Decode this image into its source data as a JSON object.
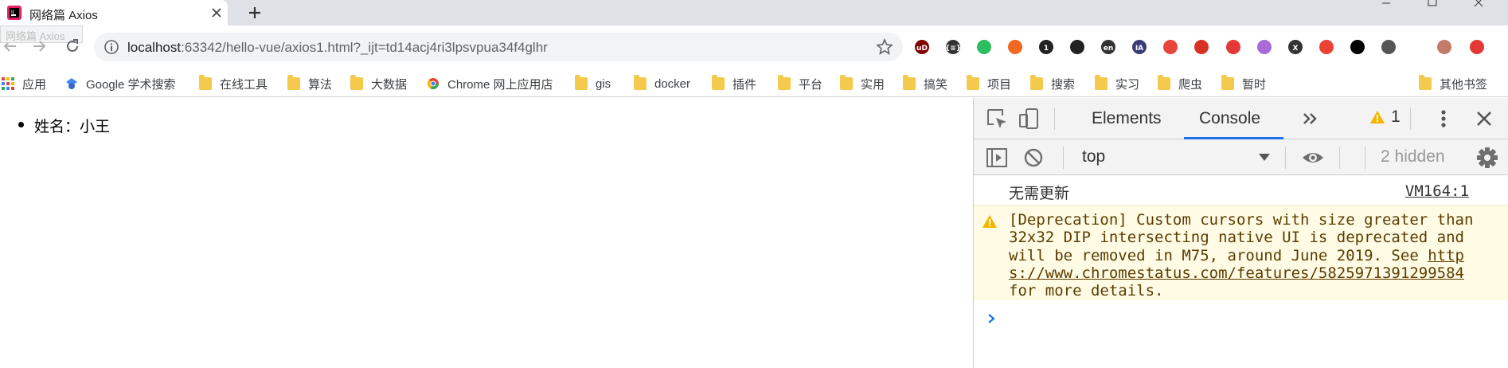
{
  "tab": {
    "title": "网络篇 Axios"
  },
  "toolbar": {
    "back_tooltip": "网络篇 Axios",
    "url_host": "localhost",
    "url_rest": ":63342/hello-vue/axios1.html?_ijt=td14acj4ri3lpsvpua34f4glhr"
  },
  "extensions": [
    {
      "name": "ublock-icon",
      "label": "uD",
      "color": "#800000"
    },
    {
      "name": "json-viewer-icon",
      "label": "{≡}",
      "color": "#333333"
    },
    {
      "name": "evernote-icon",
      "label": "",
      "color": "#2dbe60"
    },
    {
      "name": "orange-circle-icon",
      "label": "",
      "color": "#f26722"
    },
    {
      "name": "badge-extension-icon",
      "label": "1",
      "color": "#222222"
    },
    {
      "name": "mask-icon",
      "label": "",
      "color": "#222222"
    },
    {
      "name": "translate-en-icon",
      "label": "en",
      "color": "#333333"
    },
    {
      "name": "ia-icon",
      "label": "IA",
      "color": "#3b3b7a"
    },
    {
      "name": "pinwheel-icon",
      "label": "",
      "color": "#e8453c"
    },
    {
      "name": "molecule-icon",
      "label": "",
      "color": "#d93025"
    },
    {
      "name": "red-box-icon",
      "label": "",
      "color": "#e53935"
    },
    {
      "name": "purple-circle-icon",
      "label": "",
      "color": "#a96bd6"
    },
    {
      "name": "x-icon",
      "label": "X",
      "color": "#333333"
    },
    {
      "name": "map-pin-icon",
      "label": "",
      "color": "#ea4335"
    },
    {
      "name": "key-icon",
      "label": "",
      "color": "#000000"
    },
    {
      "name": "cursor-icon",
      "label": "",
      "color": "#555555"
    },
    {
      "name": "profile-icon",
      "label": "",
      "color": "#c47a6a"
    },
    {
      "name": "record-icon",
      "label": "",
      "color": "#e53935"
    }
  ],
  "bookmarks": {
    "apps": "应用",
    "items": [
      {
        "label": "Google 学术搜索",
        "icon": "google-scholar-icon"
      },
      {
        "label": "在线工具",
        "icon": "folder-icon"
      },
      {
        "label": "算法",
        "icon": "folder-icon"
      },
      {
        "label": "大数据",
        "icon": "folder-icon"
      },
      {
        "label": "Chrome 网上应用店",
        "icon": "chrome-store-icon"
      },
      {
        "label": "gis",
        "icon": "folder-icon"
      },
      {
        "label": "docker",
        "icon": "folder-icon"
      },
      {
        "label": "插件",
        "icon": "folder-icon"
      },
      {
        "label": "平台",
        "icon": "folder-icon"
      },
      {
        "label": "实用",
        "icon": "folder-icon"
      },
      {
        "label": "搞笑",
        "icon": "folder-icon"
      },
      {
        "label": "项目",
        "icon": "folder-icon"
      },
      {
        "label": "搜索",
        "icon": "folder-icon"
      },
      {
        "label": "实习",
        "icon": "folder-icon"
      },
      {
        "label": "爬虫",
        "icon": "folder-icon"
      },
      {
        "label": "暂时",
        "icon": "folder-icon"
      }
    ],
    "other": "其他书签"
  },
  "page": {
    "list_item": "姓名：小王"
  },
  "devtools": {
    "tabs": [
      "Elements",
      "Console"
    ],
    "active_tab": "Console",
    "warning_count": "1",
    "context": "top",
    "hidden": "2 hidden",
    "messages": {
      "log_text": "无需更新",
      "log_source": "VM164:1",
      "warn_prefix": "[Deprecation] Custom cursors with size greater than 32x32 DIP intersecting native UI is deprecated and will be removed in M75, around June 2019. See ",
      "warn_link": "https://www.chromestatus.com/features/5825971391299584",
      "warn_suffix": " for more details."
    }
  },
  "colors": {
    "accent": "#1a73e8",
    "warning_bg": "#fffbe5",
    "warning_icon": "#f4b400"
  }
}
